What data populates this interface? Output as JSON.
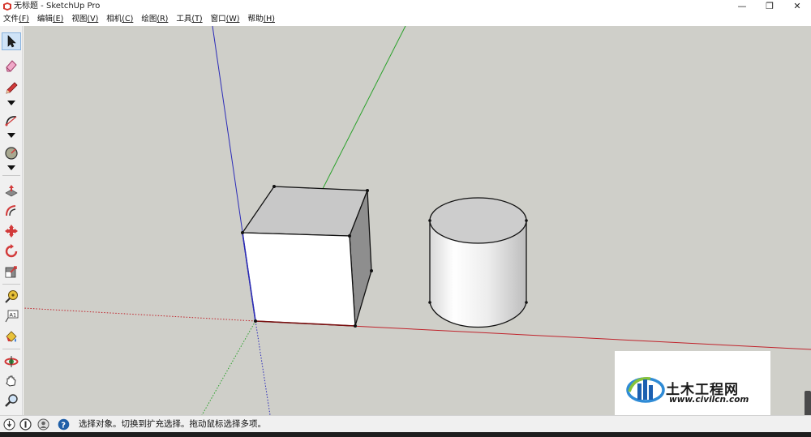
{
  "window": {
    "title": "无标题 - SketchUp Pro",
    "minimize_glyph": "—",
    "maximize_glyph": "❐",
    "close_glyph": "✕"
  },
  "menu": [
    {
      "label": "文件",
      "hotkey": "(F)"
    },
    {
      "label": "编辑",
      "hotkey": "(E)"
    },
    {
      "label": "视图",
      "hotkey": "(V)"
    },
    {
      "label": "相机",
      "hotkey": "(C)"
    },
    {
      "label": "绘图",
      "hotkey": "(R)"
    },
    {
      "label": "工具",
      "hotkey": "(T)"
    },
    {
      "label": "窗口",
      "hotkey": "(W)"
    },
    {
      "label": "帮助",
      "hotkey": "(H)"
    }
  ],
  "tools": [
    {
      "name": "select-tool",
      "icon": "arrow-cursor-icon",
      "selected": true
    },
    {
      "name": "eraser-tool",
      "icon": "eraser-icon"
    },
    {
      "name": "line-tool",
      "icon": "pencil-icon",
      "has_dropdown": true
    },
    {
      "name": "arc-tool",
      "icon": "arc-icon",
      "has_dropdown": true
    },
    {
      "name": "shape-tool",
      "icon": "circle-shape-icon",
      "has_dropdown": true
    },
    {
      "name": "push-pull-tool",
      "icon": "push-pull-icon"
    },
    {
      "name": "offset-tool",
      "icon": "offset-icon"
    },
    {
      "name": "move-tool",
      "icon": "move-icon"
    },
    {
      "name": "rotate-tool",
      "icon": "rotate-icon"
    },
    {
      "name": "scale-tool",
      "icon": "scale-icon"
    },
    {
      "name": "tape-measure-tool",
      "icon": "tape-measure-icon"
    },
    {
      "name": "text-tool",
      "icon": "text-label-icon",
      "label": "A1"
    },
    {
      "name": "paint-bucket-tool",
      "icon": "paint-bucket-icon"
    },
    {
      "name": "orbit-tool",
      "icon": "orbit-icon"
    },
    {
      "name": "pan-tool",
      "icon": "hand-icon"
    },
    {
      "name": "zoom-tool",
      "icon": "magnifier-icon"
    }
  ],
  "colors": {
    "viewport_bg": "#cfcfc9",
    "red_axis": "#c0232b",
    "green_axis": "#2aa12a",
    "blue_axis": "#2b2bb8",
    "face_front": "#ffffff",
    "face_top": "#c8c8c8",
    "face_side": "#8e8e8e"
  },
  "watermark": {
    "title": "土木工程网",
    "url": "www.civilcn.com"
  },
  "status": {
    "message": "选择对象。切换到扩充选择。拖动鼠标选择多项。"
  }
}
